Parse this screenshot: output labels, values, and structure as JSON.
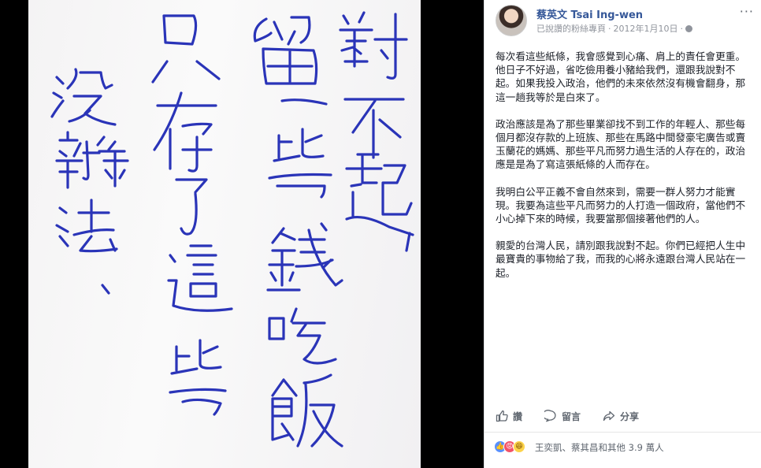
{
  "photo": {
    "handwritten_note": [
      "對不起，",
      "留一些錢吃飯",
      "只存了這些",
      "沒辦法、"
    ]
  },
  "post": {
    "author": "蔡英文 Tsai Ing-wen",
    "page_status": "已說讚的粉絲專頁",
    "separator": " · ",
    "date": "2012年1月10日",
    "paragraphs": [
      "每次看這些紙條，我會感覺到心痛、肩上的責任會更重。他日子不好過，省吃儉用養小豬給我們，還跟我說對不起。如果我投入政治，他們的未來依然沒有機會翻身，那這一趟我等於是白來了。",
      "政治應該是為了那些畢業卻找不到工作的年輕人、那些每個月都沒存款的上班族、那些在馬路中間發豪宅廣告或賣玉蘭花的媽媽、那些平凡而努力過生活的人存在的，政治應是是為了寫這張紙條的人而存在。",
      "我明白公平正義不會自然來到，需要一群人努力才能實現。我要為這些平凡而努力的人打造一個政府，當他們不小心掉下來的時候，我要當那個接著他們的人。",
      "親愛的台灣人民，請別跟我說對不起。你們已經把人生中最寶貴的事物給了我，而我的心將永遠跟台灣人民站在一起。"
    ],
    "actions": {
      "like": "讚",
      "comment": "留言",
      "share": "分享"
    },
    "reactions_summary": "王奕凱、蔡其昌和其他 3.9 萬人"
  },
  "colors": {
    "ink": "#2a34b8",
    "link": "#365899",
    "like_blue": "#5890ff"
  },
  "icons": [
    "globe-icon",
    "more-options-icon",
    "like-icon",
    "comment-icon",
    "share-icon",
    "like-reaction-icon",
    "angry-reaction-icon",
    "haha-reaction-icon"
  ]
}
